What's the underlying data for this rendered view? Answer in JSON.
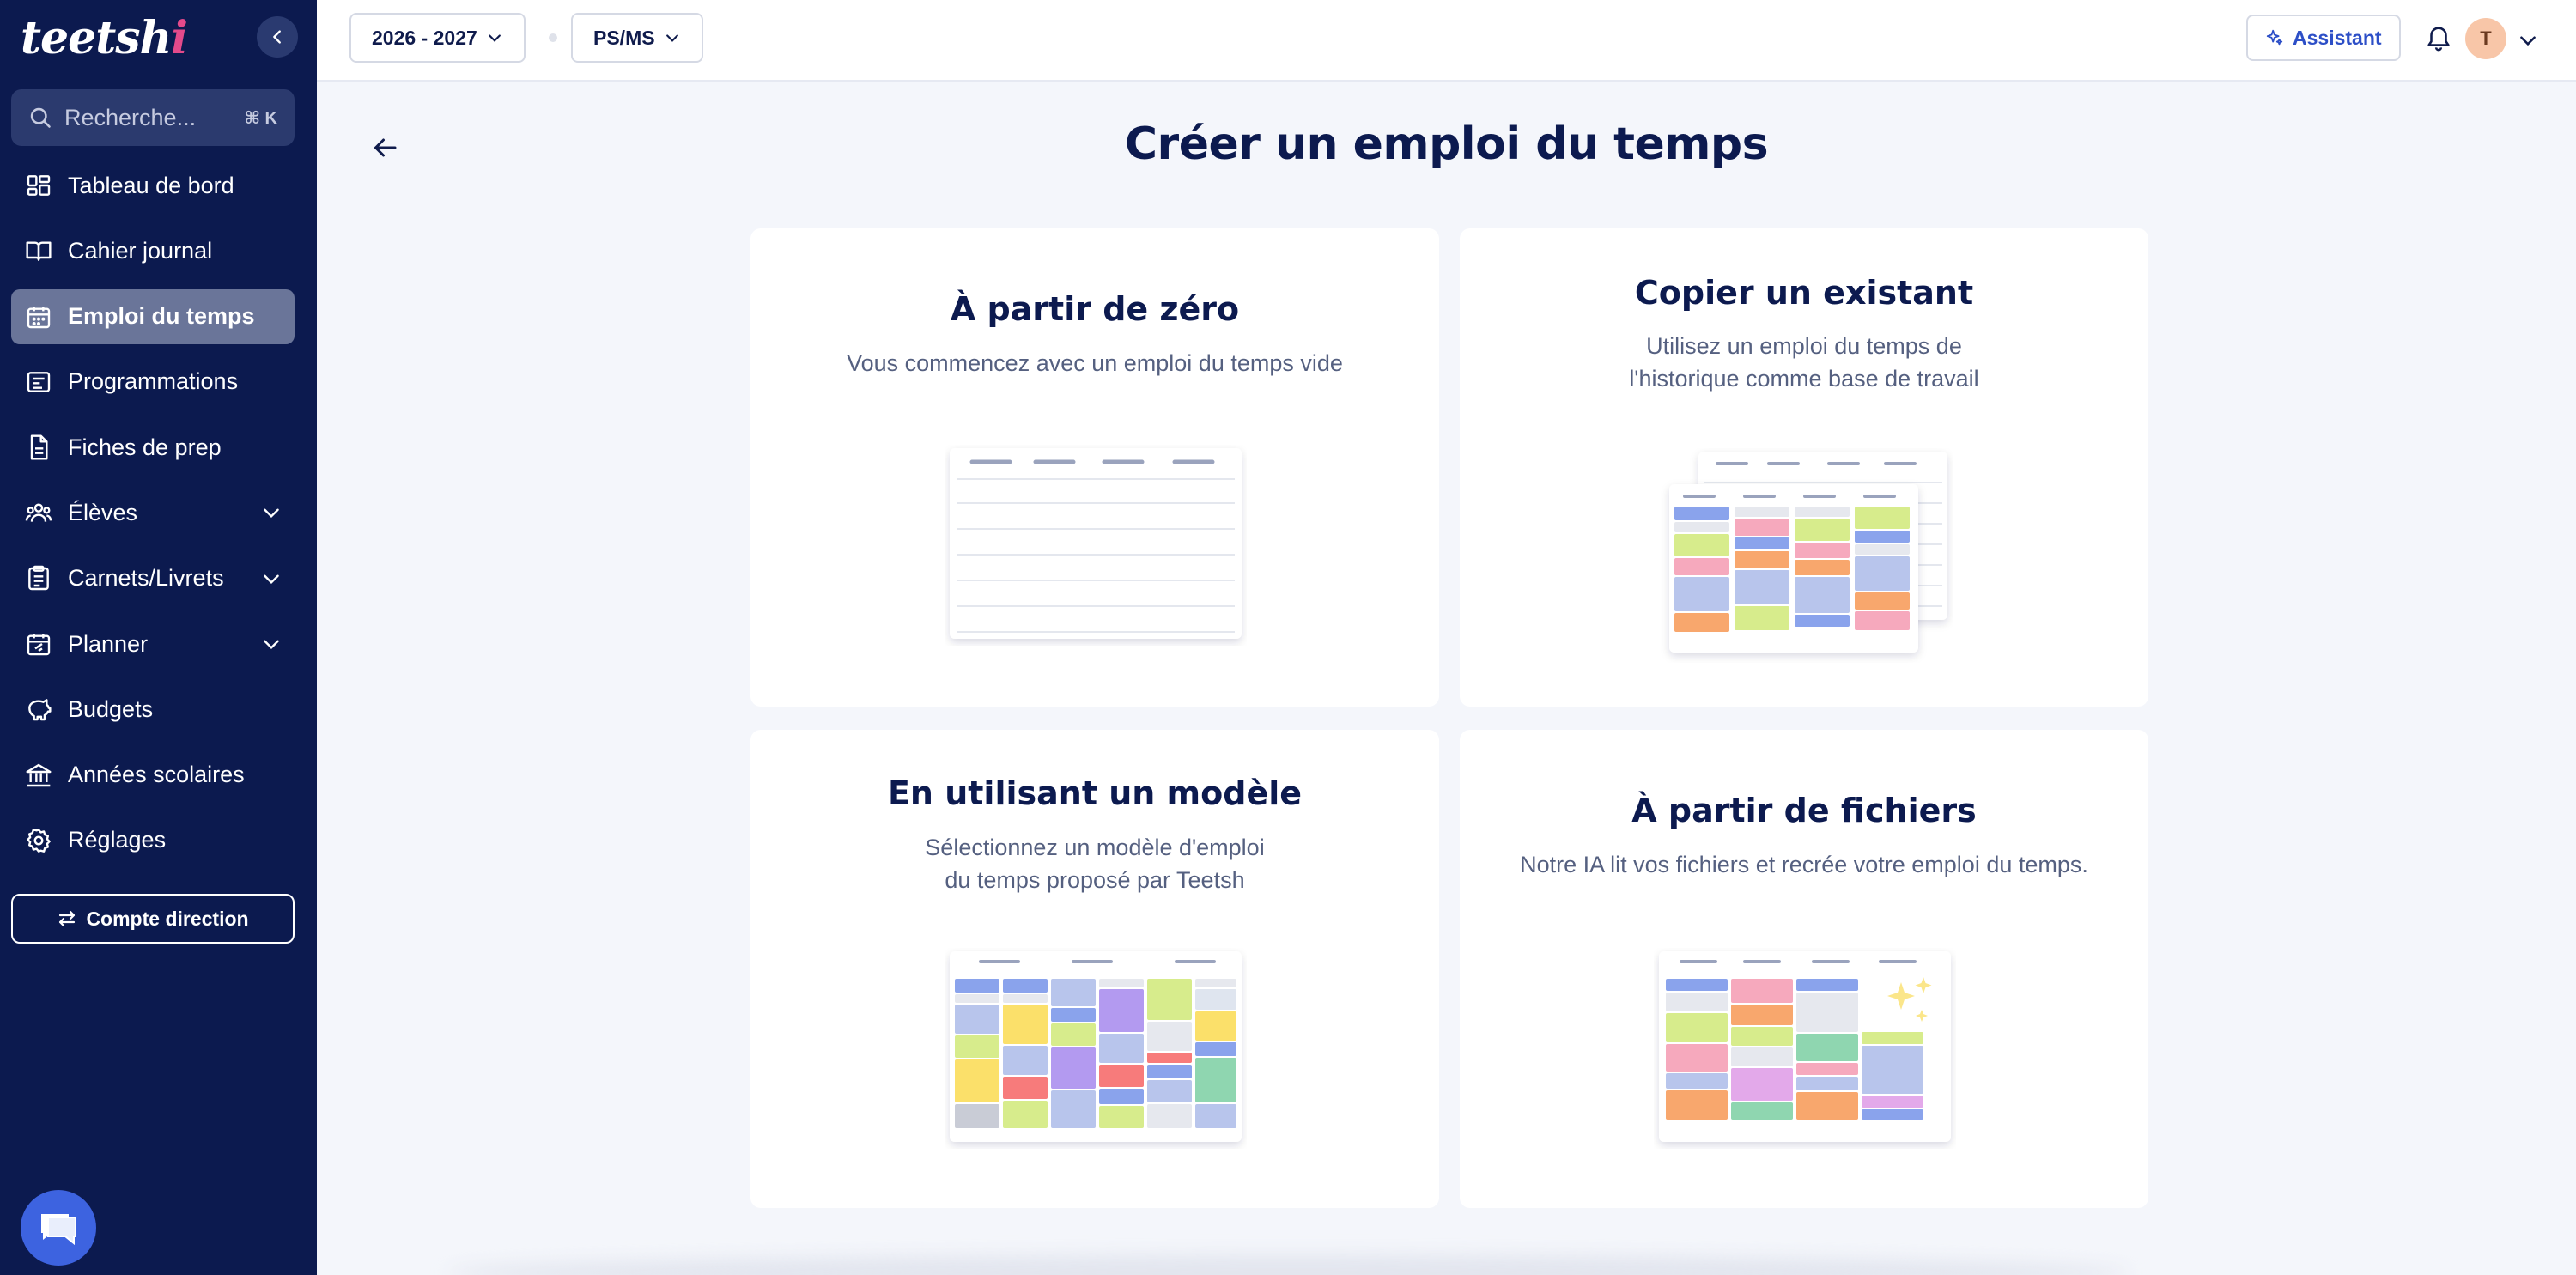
{
  "app": {
    "logo_text": "teetsh",
    "logo_accent": "i"
  },
  "search": {
    "placeholder": "Recherche...",
    "shortcut": "⌘ K"
  },
  "sidebar": {
    "items": [
      {
        "label": "Tableau de bord",
        "icon": "dashboard-icon",
        "active": false,
        "expandable": false
      },
      {
        "label": "Cahier journal",
        "icon": "book-icon",
        "active": false,
        "expandable": false
      },
      {
        "label": "Emploi du temps",
        "icon": "calendar-icon",
        "active": true,
        "expandable": false
      },
      {
        "label": "Programmations",
        "icon": "list-icon",
        "active": false,
        "expandable": false
      },
      {
        "label": "Fiches de prep",
        "icon": "file-icon",
        "active": false,
        "expandable": false
      },
      {
        "label": "Élèves",
        "icon": "users-icon",
        "active": false,
        "expandable": true
      },
      {
        "label": "Carnets/Livrets",
        "icon": "notebook-icon",
        "active": false,
        "expandable": true
      },
      {
        "label": "Planner",
        "icon": "planner-icon",
        "active": false,
        "expandable": true
      },
      {
        "label": "Budgets",
        "icon": "piggy-bank-icon",
        "active": false,
        "expandable": false
      },
      {
        "label": "Années scolaires",
        "icon": "school-icon",
        "active": false,
        "expandable": false
      },
      {
        "label": "Réglages",
        "icon": "gear-icon",
        "active": false,
        "expandable": false
      }
    ],
    "direction_button": "Compte direction"
  },
  "topbar": {
    "year_select": "2026 - 2027",
    "class_select": "PS/MS",
    "assistant_label": "Assistant",
    "avatar_initial": "T"
  },
  "main": {
    "title": "Créer un emploi du temps",
    "cards": [
      {
        "title": "À partir de zéro",
        "description": "Vous commencez avec un emploi du temps vide"
      },
      {
        "title": "Copier un existant",
        "description": "Utilisez un emploi du temps de l'historique comme base de travail"
      },
      {
        "title": "En utilisant un modèle",
        "description": "Sélectionnez un modèle d'emploi du temps proposé par Teetsh"
      },
      {
        "title": "À partir de fichiers",
        "description": "Notre IA lit vos fichiers et recrée votre emploi du temps."
      }
    ]
  },
  "colors": {
    "sidebar_bg": "#0c1a4f",
    "active_item": "#6a7599",
    "accent": "#2d4fc7",
    "chat_bubble": "#3d63e0"
  }
}
